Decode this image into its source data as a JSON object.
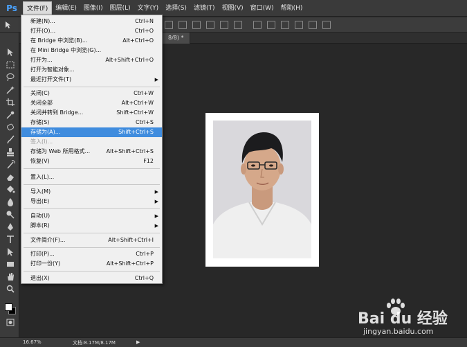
{
  "app": {
    "logo": "Ps"
  },
  "menubar": {
    "items": [
      {
        "label": "文件(F)"
      },
      {
        "label": "编辑(E)"
      },
      {
        "label": "图像(I)"
      },
      {
        "label": "图层(L)"
      },
      {
        "label": "文字(Y)"
      },
      {
        "label": "选择(S)"
      },
      {
        "label": "滤镜(T)"
      },
      {
        "label": "视图(V)"
      },
      {
        "label": "窗口(W)"
      },
      {
        "label": "帮助(H)"
      }
    ]
  },
  "doc_tab": {
    "label": "8/8) *",
    "close": "×"
  },
  "file_menu": {
    "items": [
      {
        "label": "新建(N)...",
        "shortcut": "Ctrl+N"
      },
      {
        "label": "打开(O)...",
        "shortcut": "Ctrl+O"
      },
      {
        "label": "在 Bridge 中浏览(B)...",
        "shortcut": "Alt+Ctrl+O"
      },
      {
        "label": "在 Mini Bridge 中浏览(G)...",
        "shortcut": ""
      },
      {
        "label": "打开为...",
        "shortcut": "Alt+Shift+Ctrl+O"
      },
      {
        "label": "打开为智能对象...",
        "shortcut": ""
      },
      {
        "label": "最近打开文件(T)",
        "shortcut": ""
      },
      {
        "label": "关闭(C)",
        "shortcut": "Ctrl+W"
      },
      {
        "label": "关闭全部",
        "shortcut": "Alt+Ctrl+W"
      },
      {
        "label": "关闭并转到 Bridge...",
        "shortcut": "Shift+Ctrl+W"
      },
      {
        "label": "存储(S)",
        "shortcut": "Ctrl+S"
      },
      {
        "label": "存储为(A)...",
        "shortcut": "Shift+Ctrl+S"
      },
      {
        "label": "签入(I)...",
        "shortcut": ""
      },
      {
        "label": "存储为 Web 所用格式...",
        "shortcut": "Alt+Shift+Ctrl+S"
      },
      {
        "label": "恢复(V)",
        "shortcut": "F12"
      },
      {
        "label": "置入(L)...",
        "shortcut": ""
      },
      {
        "label": "导入(M)",
        "shortcut": ""
      },
      {
        "label": "导出(E)",
        "shortcut": ""
      },
      {
        "label": "自动(U)",
        "shortcut": ""
      },
      {
        "label": "脚本(R)",
        "shortcut": ""
      },
      {
        "label": "文件简介(F)...",
        "shortcut": "Alt+Shift+Ctrl+I"
      },
      {
        "label": "打印(P)...",
        "shortcut": "Ctrl+P"
      },
      {
        "label": "打印一份(Y)",
        "shortcut": "Alt+Shift+Ctrl+P"
      },
      {
        "label": "退出(X)",
        "shortcut": "Ctrl+Q"
      }
    ]
  },
  "statusbar": {
    "zoom": "16.67%",
    "doc": "文档:8.17M/8.17M"
  },
  "watermark": {
    "brand": "Bai du 经验",
    "url": "jingyan.baidu.com"
  },
  "colors": {
    "highlight": "#3f8cde",
    "ps_blue": "#4aa3ff"
  }
}
